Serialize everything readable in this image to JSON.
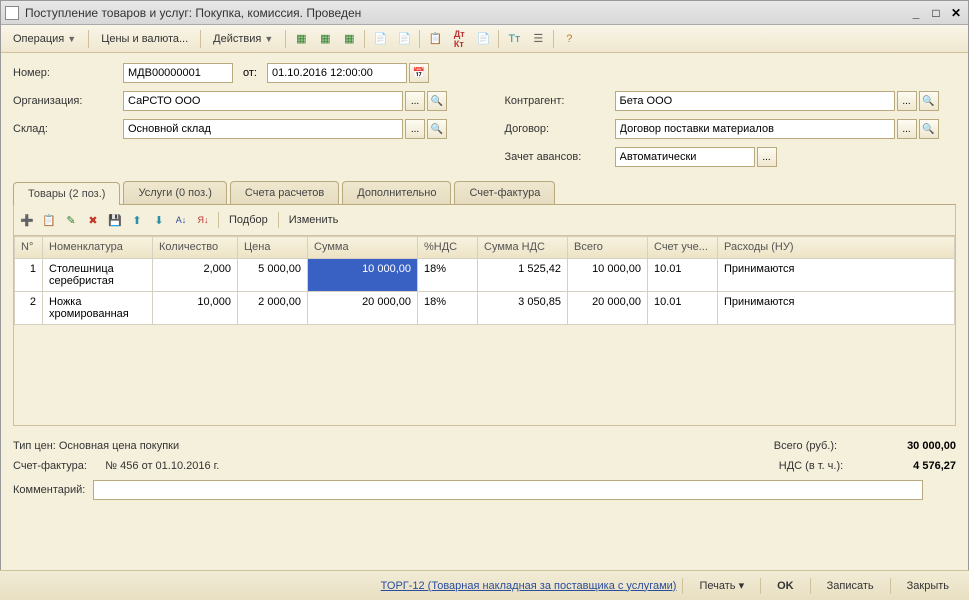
{
  "window": {
    "title": "Поступление товаров и услуг: Покупка, комиссия. Проведен"
  },
  "menu": {
    "operation": "Операция",
    "prices": "Цены и валюта...",
    "actions": "Действия"
  },
  "form": {
    "number_label": "Номер:",
    "number": "МДВ00000001",
    "from_label": "от:",
    "date": "01.10.2016 12:00:00",
    "org_label": "Организация:",
    "org": "СаРСТО ООО",
    "warehouse_label": "Склад:",
    "warehouse": "Основной склад",
    "counterparty_label": "Контрагент:",
    "counterparty": "Бета ООО",
    "contract_label": "Договор:",
    "contract": "Договор поставки материалов",
    "advance_label": "Зачет авансов:",
    "advance": "Автоматически"
  },
  "tabs": {
    "goods": "Товары (2 поз.)",
    "services": "Услуги (0 поз.)",
    "accounts": "Счета расчетов",
    "additional": "Дополнительно",
    "invoice": "Счет-фактура"
  },
  "grid_toolbar": {
    "select": "Подбор",
    "change": "Изменить"
  },
  "grid": {
    "headers": {
      "n": "N°",
      "nomenclature": "Номенклатура",
      "qty": "Количество",
      "price": "Цена",
      "sum": "Сумма",
      "vat_rate": "%НДС",
      "vat_sum": "Сумма НДС",
      "total": "Всего",
      "account": "Счет уче...",
      "expenses": "Расходы (НУ)"
    },
    "rows": [
      {
        "n": "1",
        "nomenclature": "Столешница серебристая",
        "qty": "2,000",
        "price": "5 000,00",
        "sum": "10 000,00",
        "vat_rate": "18%",
        "vat_sum": "1 525,42",
        "total": "10 000,00",
        "account": "10.01",
        "expenses": "Принимаются"
      },
      {
        "n": "2",
        "nomenclature": "Ножка хромированная",
        "qty": "10,000",
        "price": "2 000,00",
        "sum": "20 000,00",
        "vat_rate": "18%",
        "vat_sum": "3 050,85",
        "total": "20 000,00",
        "account": "10.01",
        "expenses": "Принимаются"
      }
    ]
  },
  "footer": {
    "price_type": "Тип цен: Основная цена покупки",
    "invoice_label": "Счет-фактура:",
    "invoice_value": "№ 456 от 01.10.2016 г.",
    "total_label": "Всего (руб.):",
    "total_value": "30 000,00",
    "vat_label": "НДС (в т. ч.):",
    "vat_value": "4 576,27",
    "comment_label": "Комментарий:"
  },
  "bottom": {
    "torg": "ТОРГ-12 (Товарная накладная за поставщика с услугами)",
    "print": "Печать",
    "ok": "OK",
    "save": "Записать",
    "close": "Закрыть"
  }
}
